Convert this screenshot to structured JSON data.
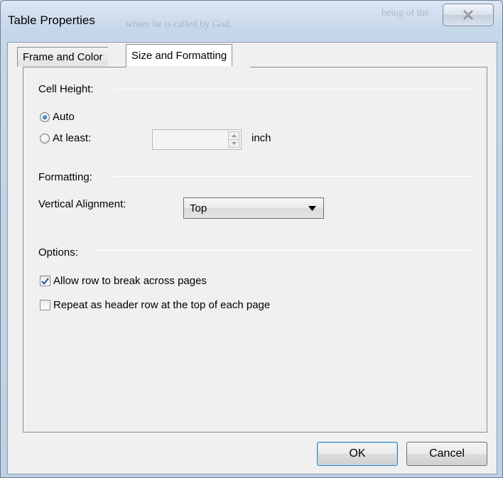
{
  "window": {
    "title": "Table Properties",
    "background_text": [
      "where he is called by God.",
      "being of the"
    ]
  },
  "tabs": [
    {
      "label": "Frame and Color",
      "active": false
    },
    {
      "label": "Size and Formatting",
      "active": true
    }
  ],
  "cell_height": {
    "group_label": "Cell Height:",
    "options": [
      {
        "label": "Auto",
        "checked": true
      },
      {
        "label": "At least:",
        "checked": false
      }
    ],
    "value": "",
    "unit": "inch"
  },
  "formatting": {
    "group_label": "Formatting:",
    "vertical_alignment_label": "Vertical Alignment:",
    "vertical_alignment_value": "Top"
  },
  "options": {
    "group_label": "Options:",
    "items": [
      {
        "label": "Allow row to break across pages",
        "checked": true
      },
      {
        "label": "Repeat as header row at the top of each page",
        "checked": false
      }
    ]
  },
  "buttons": {
    "ok": "OK",
    "cancel": "Cancel"
  },
  "icons": {
    "close": "close-icon",
    "dropdown": "chevron-down-icon",
    "spin_up": "spin-up-icon",
    "spin_down": "spin-down-icon",
    "check": "check-icon"
  },
  "colors": {
    "radio_selected": "#1c5fb4",
    "check_mark": "#1f4f9a",
    "window_frame": "#bfd0e4",
    "dialog_background": "#f0f0f0"
  }
}
